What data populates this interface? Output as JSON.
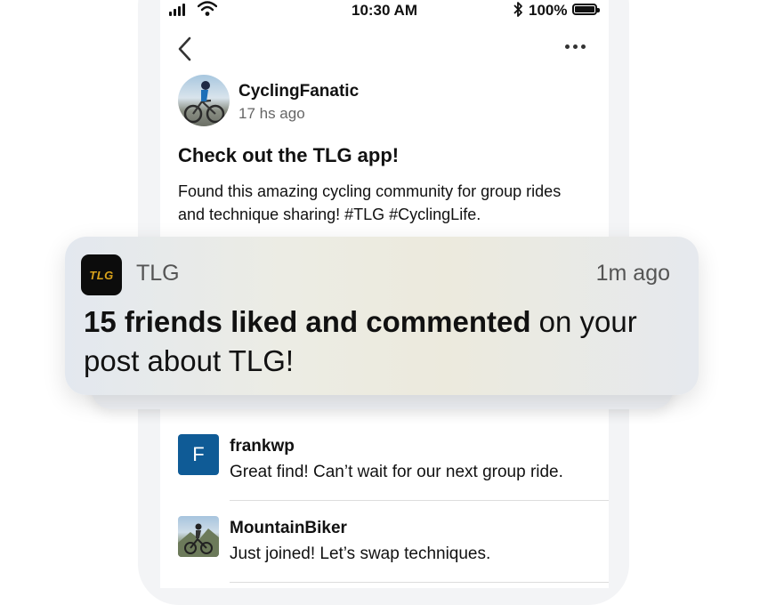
{
  "status_bar": {
    "time": "10:30 AM",
    "battery": "100%"
  },
  "post": {
    "author": "CyclingFanatic",
    "time": "17 hs ago",
    "title": "Check out the TLG app!",
    "body": "Found this amazing cycling community for group rides and technique sharing! #TLG #CyclingLife."
  },
  "notification": {
    "app_icon_text": "TLG",
    "app_name": "TLG",
    "time": "1m ago",
    "message_bold": "15 friends liked and commented",
    "message_rest": " on your post about TLG!"
  },
  "comments": [
    {
      "avatar_letter": "F",
      "user": "frankwp",
      "text": "Great find! Can’t wait for our next group ride."
    },
    {
      "user": "MountainBiker",
      "text": "Just joined! Let’s swap techniques."
    }
  ],
  "colors": {
    "accent_blue": "#0f5b96",
    "app_icon_gold": "#d9a21b"
  },
  "icons": [
    "signal-icon",
    "wifi-icon",
    "bluetooth-icon",
    "battery-icon",
    "back-icon",
    "more-icon"
  ]
}
